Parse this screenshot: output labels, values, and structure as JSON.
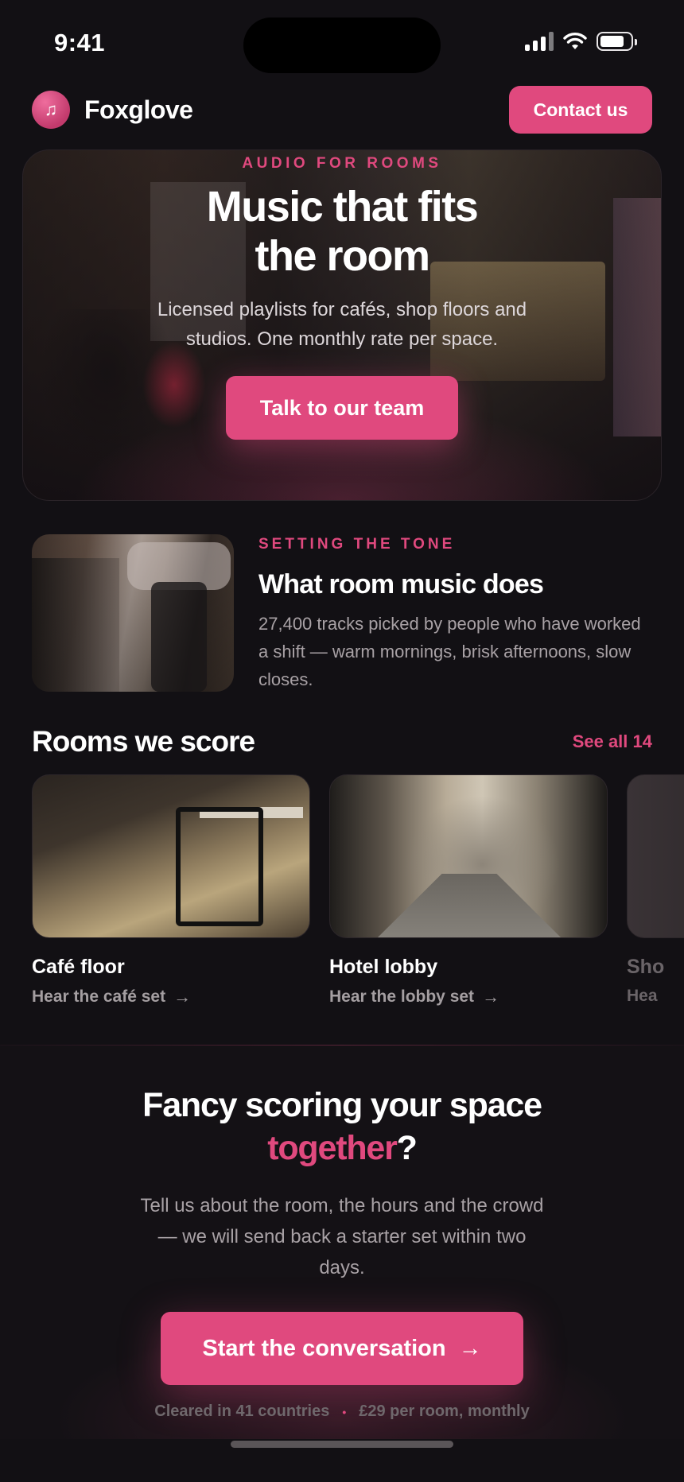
{
  "status_bar": {
    "time": "9:41",
    "icons": [
      "signal-icon",
      "wifi-icon",
      "battery-icon"
    ]
  },
  "header": {
    "brand_name": "Foxglove",
    "logo_icon": "music-note-icon",
    "contact_label": "Contact us"
  },
  "hero": {
    "eyebrow": "AUDIO FOR ROOMS",
    "title": "Music that fits the room",
    "subtitle": "Licensed playlists for cafés, shop floors and studios. One monthly rate per space.",
    "cta_label": "Talk to our team"
  },
  "tone": {
    "eyebrow": "SETTING THE TONE",
    "title": "What room music does",
    "body": "27,400 tracks picked by people who have worked a shift — warm mornings, brisk afternoons, slow closes."
  },
  "rooms": {
    "title": "Rooms we score",
    "see_all_label": "See all 14",
    "items": [
      {
        "name": "Café floor",
        "action": "Hear the café set"
      },
      {
        "name": "Hotel lobby",
        "action": "Hear the lobby set"
      },
      {
        "name": "Sho",
        "action": "Hea"
      }
    ]
  },
  "cta": {
    "title_main": "Fancy scoring your space",
    "title_accent": "together",
    "title_end": "?",
    "body": "Tell us about the room, the hours and the crowd — we will send back a starter set within two days.",
    "button_label": "Start the conversation",
    "meta_left": "Cleared in 41 countries",
    "meta_separator": "•",
    "meta_right": "£29 per room, monthly"
  },
  "colors": {
    "accent": "#e0497e",
    "background": "#121014",
    "text": "#ffffff",
    "muted": "#a8a1a5"
  }
}
